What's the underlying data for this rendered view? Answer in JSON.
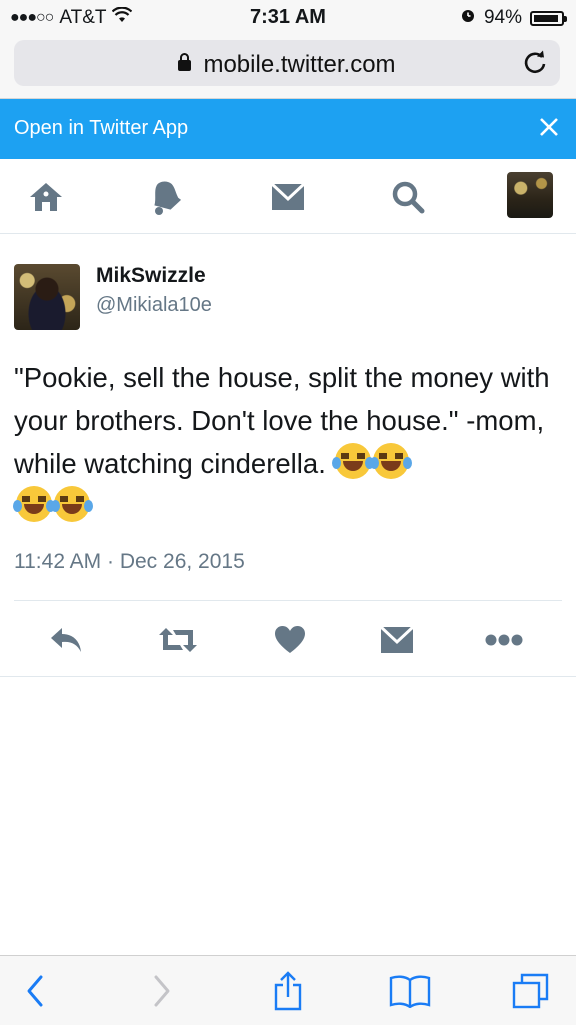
{
  "status_bar": {
    "carrier": "AT&T",
    "time": "7:31 AM",
    "battery": "94%",
    "battery_level": 0.94
  },
  "browser": {
    "url": "mobile.twitter.com"
  },
  "banner": {
    "text": "Open in Twitter App"
  },
  "nav": {
    "items": [
      "home-icon",
      "notifications-icon",
      "messages-icon",
      "search-icon",
      "profile-avatar"
    ]
  },
  "tweet": {
    "display_name": "MikSwizzle",
    "handle": "@Mikiala10e",
    "text": "\"Pookie, sell the house, split the money with your brothers. Don't love the house.\" -mom, while watching cinderella.",
    "emoji_count": 4,
    "timestamp": "11:42 AM · Dec 26, 2015"
  },
  "colors": {
    "accent": "#1da1f2",
    "secondary_text": "#657786",
    "icon": "#657786"
  }
}
